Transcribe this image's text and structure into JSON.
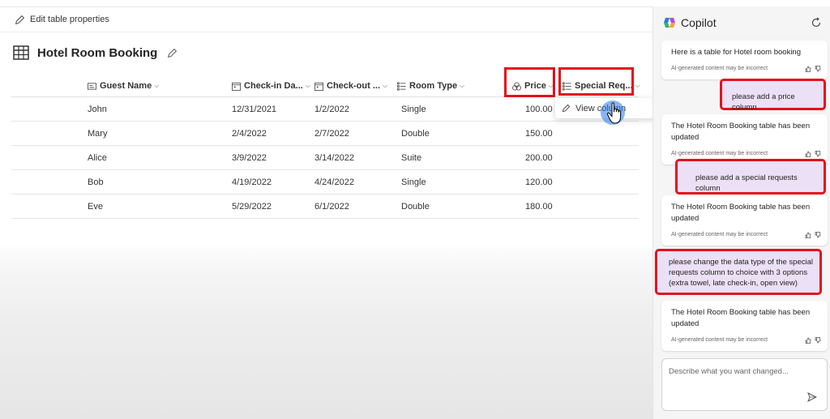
{
  "toolbar": {
    "edit_label": "Edit table properties"
  },
  "table": {
    "title": "Hotel Room Booking",
    "columns": [
      {
        "label": "Guest Name",
        "icon": "text-column-icon"
      },
      {
        "label": "Check-in Da...",
        "icon": "calendar-icon"
      },
      {
        "label": "Check-out ...",
        "icon": "calendar-icon"
      },
      {
        "label": "Room Type",
        "icon": "choice-icon"
      },
      {
        "label": "Price",
        "icon": "currency-icon"
      },
      {
        "label": "Special Req...",
        "icon": "choice-icon"
      }
    ],
    "rows": [
      [
        "John",
        "12/31/2021",
        "1/2/2022",
        "Single",
        "100.00"
      ],
      [
        "Mary",
        "2/4/2022",
        "2/7/2022",
        "Double",
        "150.00"
      ],
      [
        "Alice",
        "3/9/2022",
        "3/14/2022",
        "Suite",
        "200.00"
      ],
      [
        "Bob",
        "4/19/2022",
        "4/24/2022",
        "Single",
        "120.00"
      ],
      [
        "Eve",
        "5/29/2022",
        "6/1/2022",
        "Double",
        "180.00"
      ]
    ]
  },
  "menu": {
    "view_column": "View column"
  },
  "copilot": {
    "title": "Copilot",
    "disclaimer": "AI-generated content may be incorrect",
    "messages": [
      {
        "role": "ai",
        "text": "Here is a table for Hotel room booking"
      },
      {
        "role": "user",
        "text": "please add a price column"
      },
      {
        "role": "ai",
        "text": "The Hotel Room Booking table has been updated"
      },
      {
        "role": "user",
        "text": "please add a special requests column"
      },
      {
        "role": "ai",
        "text": "The Hotel Room Booking table has been updated"
      },
      {
        "role": "user",
        "text": "please change the data type of the special requests column to choice with 3 options (extra towel, late check-in, open view)"
      },
      {
        "role": "ai",
        "text": "The Hotel Room Booking table has been updated"
      }
    ],
    "input_placeholder": "Describe what you want changed..."
  },
  "colors": {
    "highlight": "#e3101e",
    "user_bubble": "#ebe0f5",
    "cursor_glow": "#2878f0"
  }
}
